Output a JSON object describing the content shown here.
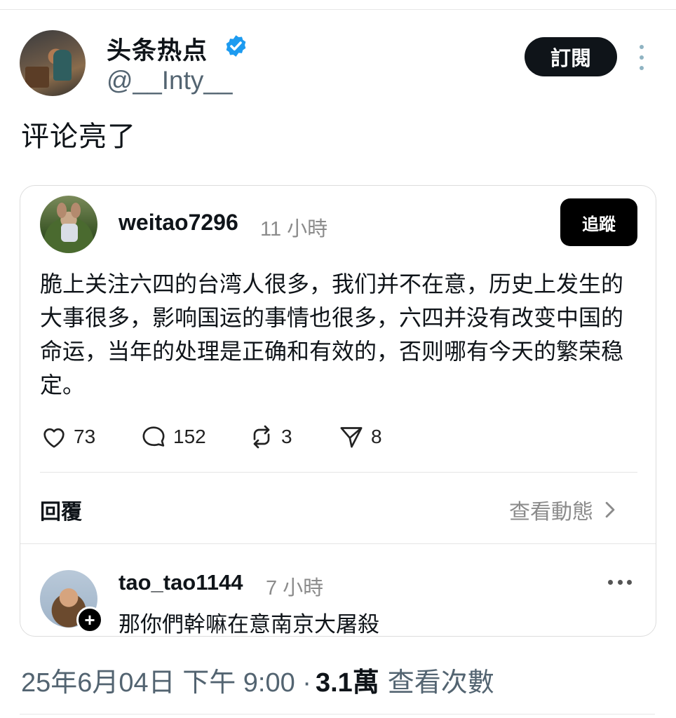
{
  "post": {
    "display_name": "头条热点",
    "handle": "@__Inty__",
    "subscribe_label": "訂閱",
    "text": "评论亮了",
    "date_time": "25年6月04日 下午 9:00 ·",
    "views_count": "3.1萬",
    "views_label": "查看次數"
  },
  "quoted": {
    "username": "weitao7296",
    "time": "11 小時",
    "follow_label": "追蹤",
    "body": "脆上关注六四的台湾人很多，我们并不在意，历史上发生的大事很多，影响国运的事情也很多，六四并没有改变中国的命运，当年的处理是正确和有效的，否则哪有今天的繁荣稳定。",
    "likes": "73",
    "comments": "152",
    "reposts": "3",
    "shares": "8",
    "reply_label": "回覆",
    "view_activity_label": "查看動態"
  },
  "reply": {
    "username": "tao_tao1144",
    "time": "7 小時",
    "text": "那你們幹嘛在意南京大屠殺"
  },
  "colors": {
    "verified": "#1d9bf0",
    "muted": "#536471",
    "button_bg": "#0f1419"
  }
}
